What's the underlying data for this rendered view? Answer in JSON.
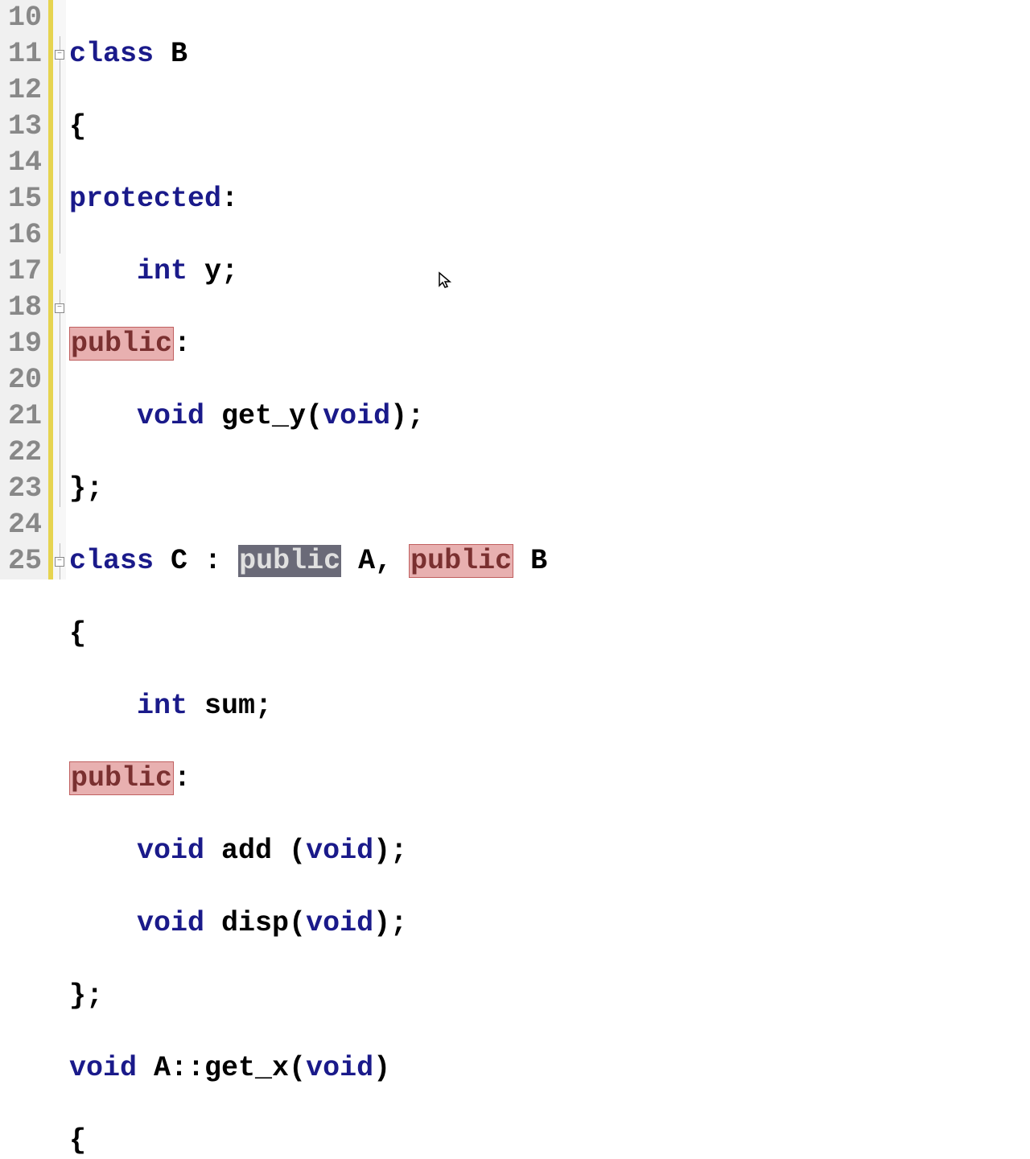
{
  "editor": {
    "line_start": 10,
    "lines": {
      "l10": {
        "class": "class",
        "name": " B"
      },
      "l11": {
        "brace": "{"
      },
      "l12": {
        "kw": "protected",
        "colon": ":"
      },
      "l13": {
        "kw": "int",
        "rest": " y;"
      },
      "l14": {
        "kw": "public",
        "colon": ":"
      },
      "l15": {
        "kw1": "void",
        "fn": " get_y(",
        "kw2": "void",
        "tail": ");"
      },
      "l16": {
        "brace": "};"
      },
      "l17": {
        "class": "class",
        "name": " C : ",
        "pub1": "public",
        "a": " A, ",
        "pub2": "public",
        "b": " B"
      },
      "l18": {
        "brace": "{"
      },
      "l19": {
        "kw": "int",
        "rest": " sum;"
      },
      "l20": {
        "kw": "public",
        "colon": ":"
      },
      "l21": {
        "kw1": "void",
        "fn": " add (",
        "kw2": "void",
        "tail": ");"
      },
      "l22": {
        "kw1": "void",
        "fn": " disp(",
        "kw2": "void",
        "tail": ");"
      },
      "l23": {
        "brace": "};"
      },
      "l24": {
        "kw1": "void",
        "scope": " A::get_x(",
        "kw2": "void",
        "tail": ")"
      },
      "l25": {
        "brace": "{"
      }
    },
    "line_numbers": [
      "10",
      "11",
      "12",
      "13",
      "14",
      "15",
      "16",
      "17",
      "18",
      "19",
      "20",
      "21",
      "22",
      "23",
      "24",
      "25"
    ]
  }
}
